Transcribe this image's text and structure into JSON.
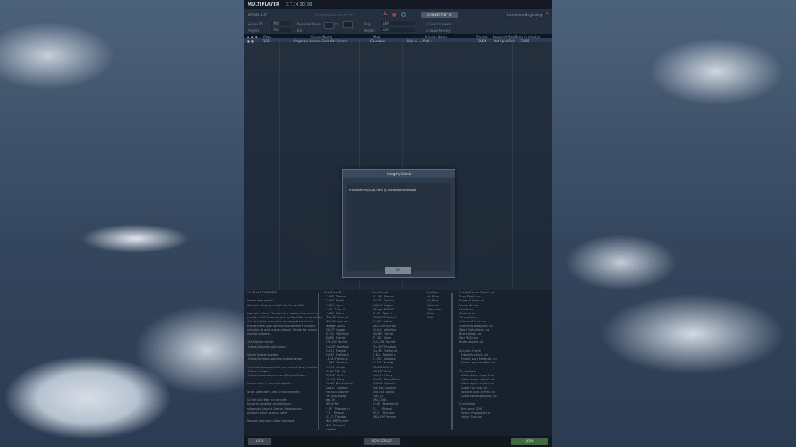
{
  "app": {
    "title": "MULTIPLAYER",
    "version": "2.7.14.30193"
  },
  "toolbar": {
    "server_list": "SERVER LIST",
    "mid_text": "Connected to server list",
    "connect_label": "CONNECT BY IP",
    "user": "Lieutenant Brightwing"
  },
  "filters": {
    "name_label": "Server ID",
    "name_value": "ANY",
    "players_label": "Players",
    "players_value": "ANY",
    "required_label": "Required Mods",
    "required_value": "",
    "ping_label": "Ping",
    "ping_value": "ANY",
    "region_label": "Region",
    "region_value": "ANY",
    "era_label": "Era",
    "era_value": "ANY",
    "search_label": "Search server",
    "favorite_label": "Favorite only"
  },
  "table": {
    "headers": [
      "Ping",
      "Server Name",
      "Map",
      "Mission Name",
      "Players",
      "Required Mods",
      "Time in mission"
    ],
    "row": [
      "100",
      "Enigma's Reborn Cold War Server",
      "Caucasus",
      "Blue & ..., Red ...",
      "10/64",
      "Not Specified",
      "13:00"
    ]
  },
  "detail": {
    "col1": "22:58 at 21 SUMMER\n\nServer Description\nWelcome Enigma's Cold War Server Site\n\nOperation Clear Thunder is a mission that aims to\nprovide a PvP environment for Cold War era aviation.\nThis is only for primarily one-way-direct to the\nenvironment with a mixture of different factions\nincluding AI and human placed. Server for senior\naviation players.\n\nThe Discord server\n  https://discord.gg/enigma\n\nServer Status Overlay\n  https://enigma.gaming/coldwarserver\n\nThe web to support this server and keep it online\n  Patron Support\n  https://www.patreon.com/EnigmaReborn\n\nServer rules / more settings & ...\n\nWhat Operation Clear Thunder offers\n\nAll the Cold War era aircraft\nDynamic weather and missions\nAdvanced Ground Control Interception\nAbility to place ground units\n\nFeature overview: https://enigma",
    "col2": "Slot Aircraft\n  F-14B  Tomcat\n  F-15C  Eagle\n  F-16C  Viper\n  F-5E   Tiger II\n  F-86F  Sabre\n  MiG-21 Fishbed\n  MiG-29 Fulcrum\n  Mirage 2000C\n  AJS-37 Viggen\n  A-10C  Warthog\n  AV-8B  Harrier\n  F/A-18C Hornet\n  Su-25T Frogfoot\n  Su-27  Flanker\n  Su-33  Flanker-D\n  J-11A  Flanker-L\n  L-39C  Albatros\n  C-101  Aviojet\n  Mi-8MTV2 Hip\n  Mi-24P Hind\n  UH-1H  Huey\n  Ka-50  Black Shark\n  SA342  Gazelle\n  AH-64D Apache\n  OH-58D Kiowa\n  Yak-52\n  MB-339A\n  F-4E   Phantom II\n  F-1    Mirage\n  JF-17  Thunder\n  MiG-19P Farmer\n  MiG-15 Fagot\n  Spitfire",
    "col3": "Slot Aircraft\n  F-14B  Tomcat\n  Su-27  Flanker\n  AJS-37 Viggen\n  Mirage 2000C\n  F-5E   Tiger II\n  MiG-21 Fishbed\n  F-86F  Sabre\n  MiG-29 Fulcrum\n  A-10C  Warthog\n  AV-8B  Harrier\n  F-16C  Viper\n  F/A-18C Hornet\n  Su-25T Frogfoot\n  Su-33  Flanker-D\n  J-11A  Flanker-L\n  L-39C  Albatros\n  C-101  Aviojet\n  Mi-8MTV2 Hip\n  Mi-24P Hind\n  UH-1H  Huey\n  Ka-50  Black Shark\n  SA342  Gazelle\n  AH-64D Apache\n  OH-58D Kiowa\n  Yak-52\n  MB-339A\n  F-4E   Phantom II\n  F-1    Mirage\n  JF-17  Thunder\n  MiG-19P Farmer",
    "col4": "Coalition\n  All Blue\n  All Red\n  Neutral\n  Spectator\n  Blue\n  Red",
    "col5": "Cockpit Visual Recon: on\nEasy Flight: no\nExternal View: on\nImmortal: no\nLabels: on\nPadlock: on\nTime of Day: ..\nUnlimited Fuel: no\nUnlimited Weapons: no\nWake Turbulence: no\nBird Strikes: no\nMini HUD: no\nRadio Assists: on\n\nSecurity Check\n  Integrity check: on\n  Ensure pure textures: on\n  Ensure pure models: on\n\nPermissions\n  Allow player export: on\n  Allow sensor export: on\n  Allow object export: no\n  Allow trial only: on\n  Require pure clients: on\n  Allow ownship export: on\n\nConnection\n  Max ping: 250\n  Server Password: no\n  Voice Chat: on"
  },
  "bottom": {
    "back": "BACK",
    "new_server": "NEW SERVER",
    "join": "JOIN"
  },
  "modal": {
    "title": "IntegrityCheck",
    "message": "mismatching:Ddj.edm @ bazar/world/shape",
    "ok": "OK"
  },
  "colors": {
    "accent_join": "#3e6c3c",
    "warn": "#d4a23a",
    "error": "#b03a3a"
  }
}
